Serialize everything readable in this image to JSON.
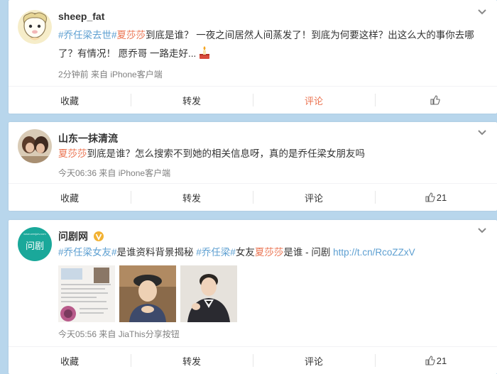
{
  "posts": [
    {
      "user": "sheep_fat",
      "content": [
        {
          "t": "#乔任梁去世#",
          "c": "topicb"
        },
        {
          "t": "夏莎莎",
          "c": "topic"
        },
        {
          "t": "到底是谁？ 一夜之间居然人间蒸发了！到底为何要这样？出这么大的事你去哪了？有情况！ 愿乔哥 一路走好...",
          "c": ""
        }
      ],
      "meta": "2分钟前 来自 iPhone客户端",
      "actions": {
        "collect": "收藏",
        "forward": "转发",
        "comment": "评论",
        "like": ""
      }
    },
    {
      "user": "山东一抹清流",
      "content": [
        {
          "t": "夏莎莎",
          "c": "topic"
        },
        {
          "t": "到底是谁？怎么搜索不到她的相关信息呀，真的是乔任梁女朋友吗",
          "c": ""
        }
      ],
      "meta": "今天06:36 来自 iPhone客户端",
      "actions": {
        "collect": "收藏",
        "forward": "转发",
        "comment": "评论",
        "like": "21"
      }
    },
    {
      "user": "问剧网",
      "avatar_text": "问剧",
      "avatar_sub": "www.wenjutv.com",
      "content": [
        {
          "t": "#乔任梁女友#",
          "c": "topicb"
        },
        {
          "t": "是谁资料背景揭秘 ",
          "c": ""
        },
        {
          "t": "#乔任梁#",
          "c": "topicb"
        },
        {
          "t": "女友",
          "c": ""
        },
        {
          "t": "夏莎莎",
          "c": "topic"
        },
        {
          "t": "是谁 - 问剧 ",
          "c": ""
        },
        {
          "t": "http://t.cn/RcoZZxV",
          "c": "link"
        }
      ],
      "meta": "今天05:56 来自 JiaThis分享按钮",
      "actions": {
        "collect": "收藏",
        "forward": "转发",
        "comment": "评论",
        "like": "21"
      }
    }
  ],
  "colors": {
    "background": "#b8d6ec",
    "topic": "#eb7350",
    "link": "#5d9fd1",
    "meta": "#808080"
  },
  "icons": [
    "chevron-down-icon",
    "like-icon",
    "verified-icon"
  ]
}
